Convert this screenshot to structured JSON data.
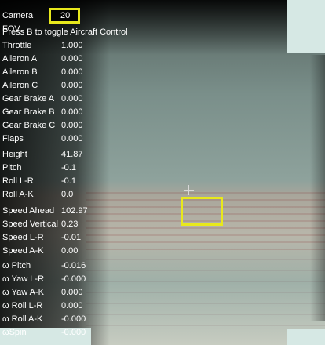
{
  "camera": {
    "fov_label": "Camera FOV",
    "fov_value": "20"
  },
  "toggle_hint": "Press B to toggle Aircraft Control",
  "telemetry": [
    {
      "label": "Throttle",
      "value": "1.000"
    },
    {
      "label": "Aileron A",
      "value": "0.000"
    },
    {
      "label": "Aileron B",
      "value": "0.000"
    },
    {
      "label": "Aileron C",
      "value": "0.000"
    },
    {
      "label": "Gear Brake A",
      "value": "0.000"
    },
    {
      "label": "Gear Brake B",
      "value": "0.000"
    },
    {
      "label": "Gear Brake C",
      "value": "0.000"
    },
    {
      "label": "Flaps",
      "value": "0.000"
    },
    {
      "label": "Height",
      "value": "41.87"
    },
    {
      "label": "Pitch",
      "value": "-0.1"
    },
    {
      "label": "Roll L-R",
      "value": "-0.1"
    },
    {
      "label": "Roll A-K",
      "value": "0.0"
    },
    {
      "label": "Speed Ahead",
      "value": "102.97"
    },
    {
      "label": "Speed Vertical",
      "value": "0.23"
    },
    {
      "label": "Speed L-R",
      "value": "-0.01"
    },
    {
      "label": "Speed A-K",
      "value": "0.00"
    },
    {
      "label": "ω Pitch",
      "value": "-0.016"
    },
    {
      "label": "ω Yaw L-R",
      "value": "-0.000"
    },
    {
      "label": "ω Yaw A-K",
      "value": "0.000"
    },
    {
      "label": "ω Roll L-R",
      "value": "0.000"
    },
    {
      "label": "ω Roll A-K",
      "value": "-0.000"
    },
    {
      "label": "ωSpin",
      "value": "-0.000"
    }
  ],
  "colors": {
    "highlight": "#e8e81c",
    "corner_panel": "#d6e8e4",
    "text": "#ffffff"
  }
}
